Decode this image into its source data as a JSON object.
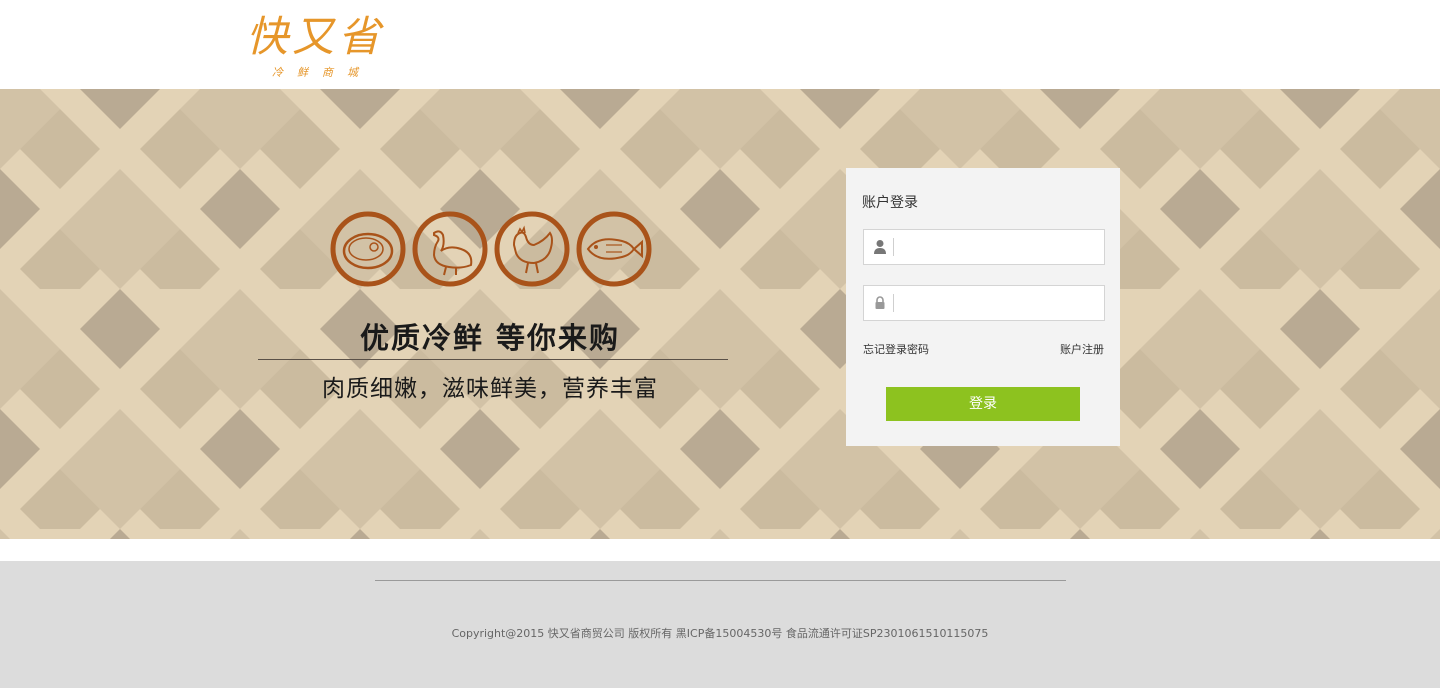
{
  "header": {
    "logo_main": "快又省",
    "logo_sub": "冷鲜商城"
  },
  "hero": {
    "icons": [
      "steak-icon",
      "goose-icon",
      "rooster-icon",
      "fish-icon"
    ],
    "slogan": "优质冷鲜  等你来购",
    "tagline": "肉质细嫩，滋味鲜美，营养丰富"
  },
  "login": {
    "title": "账户登录",
    "username_placeholder": "",
    "password_placeholder": "",
    "forgot_password": "忘记登录密码",
    "register": "账户注册",
    "submit": "登录"
  },
  "footer": {
    "copyright": "Copyright@2015 快又省商贸公司 版权所有 黑ICP备15004530号 食品流通许可证SP2301061510115075"
  },
  "colors": {
    "brand_orange": "#e6962a",
    "icon_brown": "#a9531a",
    "login_green": "#8dc21f",
    "banner_beige": "#e3d3b6"
  }
}
